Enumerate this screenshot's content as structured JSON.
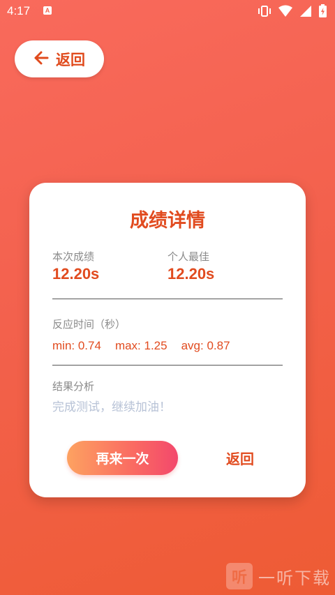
{
  "status_bar": {
    "time": "4:17",
    "notification_badge": "A"
  },
  "back_pill": {
    "label": "返回",
    "icon": "arrow-left-icon"
  },
  "card": {
    "title": "成绩详情",
    "current_score": {
      "label": "本次成绩",
      "value": "12.20s"
    },
    "best_score": {
      "label": "个人最佳",
      "value": "12.20s"
    },
    "reaction": {
      "label": "反应时间（秒）",
      "min": "min: 0.74",
      "max": "max: 1.25",
      "avg": "avg: 0.87"
    },
    "analysis": {
      "label": "结果分析",
      "text": "完成测试，继续加油！"
    },
    "again_button": "再来一次",
    "return_button": "返回"
  },
  "watermark": {
    "logo_char": "听",
    "text": "一听下载"
  },
  "colors": {
    "accent": "#e14b1f",
    "background_top": "#f96a5c",
    "background_bottom": "#ee5b34"
  }
}
